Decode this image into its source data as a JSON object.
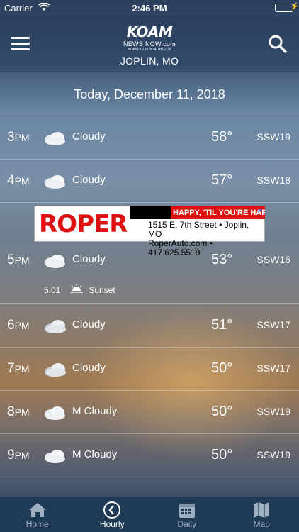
{
  "status_bar": {
    "carrier": "Carrier",
    "time": "2:46 PM"
  },
  "header": {
    "brand": "KOAM",
    "brand_sub": "NEWS NOW.com",
    "brand_sub2": "KOAM-TV  FOX14  THE CW",
    "location": "JOPLIN, MO"
  },
  "date": "Today, December 11, 2018",
  "rows": [
    {
      "hour": "3",
      "ampm": "PM",
      "condition": "Cloudy",
      "temp": "58°",
      "wind": "SSW19",
      "icon": "cloud-icon"
    },
    {
      "hour": "4",
      "ampm": "PM",
      "condition": "Cloudy",
      "temp": "57°",
      "wind": "SSW18",
      "icon": "cloud-icon"
    },
    {
      "hour": "5",
      "ampm": "PM",
      "condition": "Cloudy",
      "temp": "53°",
      "wind": "SSW16",
      "icon": "cloud-icon"
    },
    {
      "hour": "6",
      "ampm": "PM",
      "condition": "Cloudy",
      "temp": "51°",
      "wind": "SSW17",
      "icon": "cloud-night-icon"
    },
    {
      "hour": "7",
      "ampm": "PM",
      "condition": "Cloudy",
      "temp": "50°",
      "wind": "SSW17",
      "icon": "cloud-night-icon"
    },
    {
      "hour": "8",
      "ampm": "PM",
      "condition": "M Cloudy",
      "temp": "50°",
      "wind": "SSW19",
      "icon": "cloud-icon"
    },
    {
      "hour": "9",
      "ampm": "PM",
      "condition": "M Cloudy",
      "temp": "50°",
      "wind": "SSW19",
      "icon": "cloud-icon"
    }
  ],
  "sunset": {
    "time": "5:01",
    "label": "Sunset"
  },
  "ad": {
    "brand": "ROPER",
    "tagline": "HAPPY, 'TIL YOU'RE HAPP",
    "address": "1515 E. 7th Street • Joplin, MO",
    "contact": "RoperAuto.com • 417.625.5519"
  },
  "tabs": [
    {
      "label": "Home",
      "icon": "home-icon"
    },
    {
      "label": "Hourly",
      "icon": "clock-icon"
    },
    {
      "label": "Daily",
      "icon": "calendar-icon"
    },
    {
      "label": "Map",
      "icon": "map-icon"
    }
  ]
}
